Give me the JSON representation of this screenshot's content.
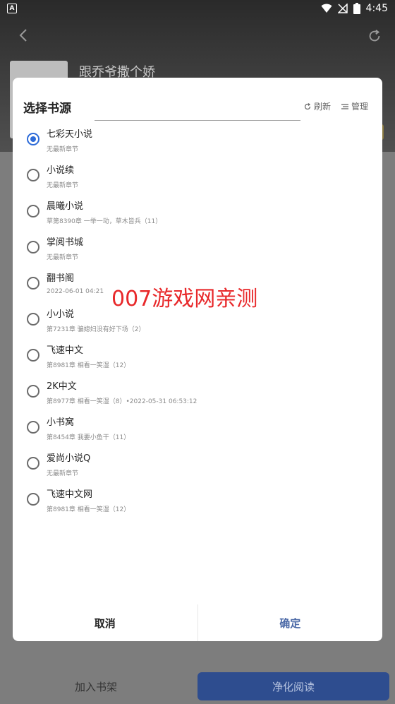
{
  "status_bar": {
    "left_icon_letter": "A",
    "time": "4:45"
  },
  "background": {
    "book_title": "跟乔爷撒个娇",
    "add_to_shelf": "加入书架",
    "clean_read": "净化阅读"
  },
  "dialog": {
    "title": "选择书源",
    "refresh_label": "刷新",
    "manage_label": "管理",
    "cancel_label": "取消",
    "confirm_label": "确定",
    "watermark": "007游戏网亲测",
    "sources": [
      {
        "name": "七彩天小说",
        "sub": "无最新章节",
        "selected": true
      },
      {
        "name": "小说续",
        "sub": "无最新章节",
        "selected": false
      },
      {
        "name": "晨曦小说",
        "sub": "草第8390章 一举一动，草木皆兵（11）",
        "selected": false
      },
      {
        "name": "掌阅书城",
        "sub": "无最新章节",
        "selected": false
      },
      {
        "name": "翻书阁",
        "sub": "2022-06-01 04:21",
        "selected": false
      },
      {
        "name": "小小说",
        "sub": "第7231章 骗媳妇没有好下场（2）",
        "selected": false
      },
      {
        "name": "飞速中文",
        "sub": "第8981章 相看一笑湿（12）",
        "selected": false
      },
      {
        "name": "2K中文",
        "sub": "第8977章 相看一笑湿（8）•2022-05-31 06:53:12",
        "selected": false
      },
      {
        "name": "小书窝",
        "sub": "第8454章 我要小鱼干（11）",
        "selected": false
      },
      {
        "name": "爱尚小说Q",
        "sub": "无最新章节",
        "selected": false
      },
      {
        "name": "飞速中文网",
        "sub": "第8981章 相看一笑湿（12）",
        "selected": false
      }
    ]
  },
  "colors": {
    "accent": "#2d6bd8",
    "primary_button": "#2e4d8f",
    "watermark": "#e8282a"
  }
}
